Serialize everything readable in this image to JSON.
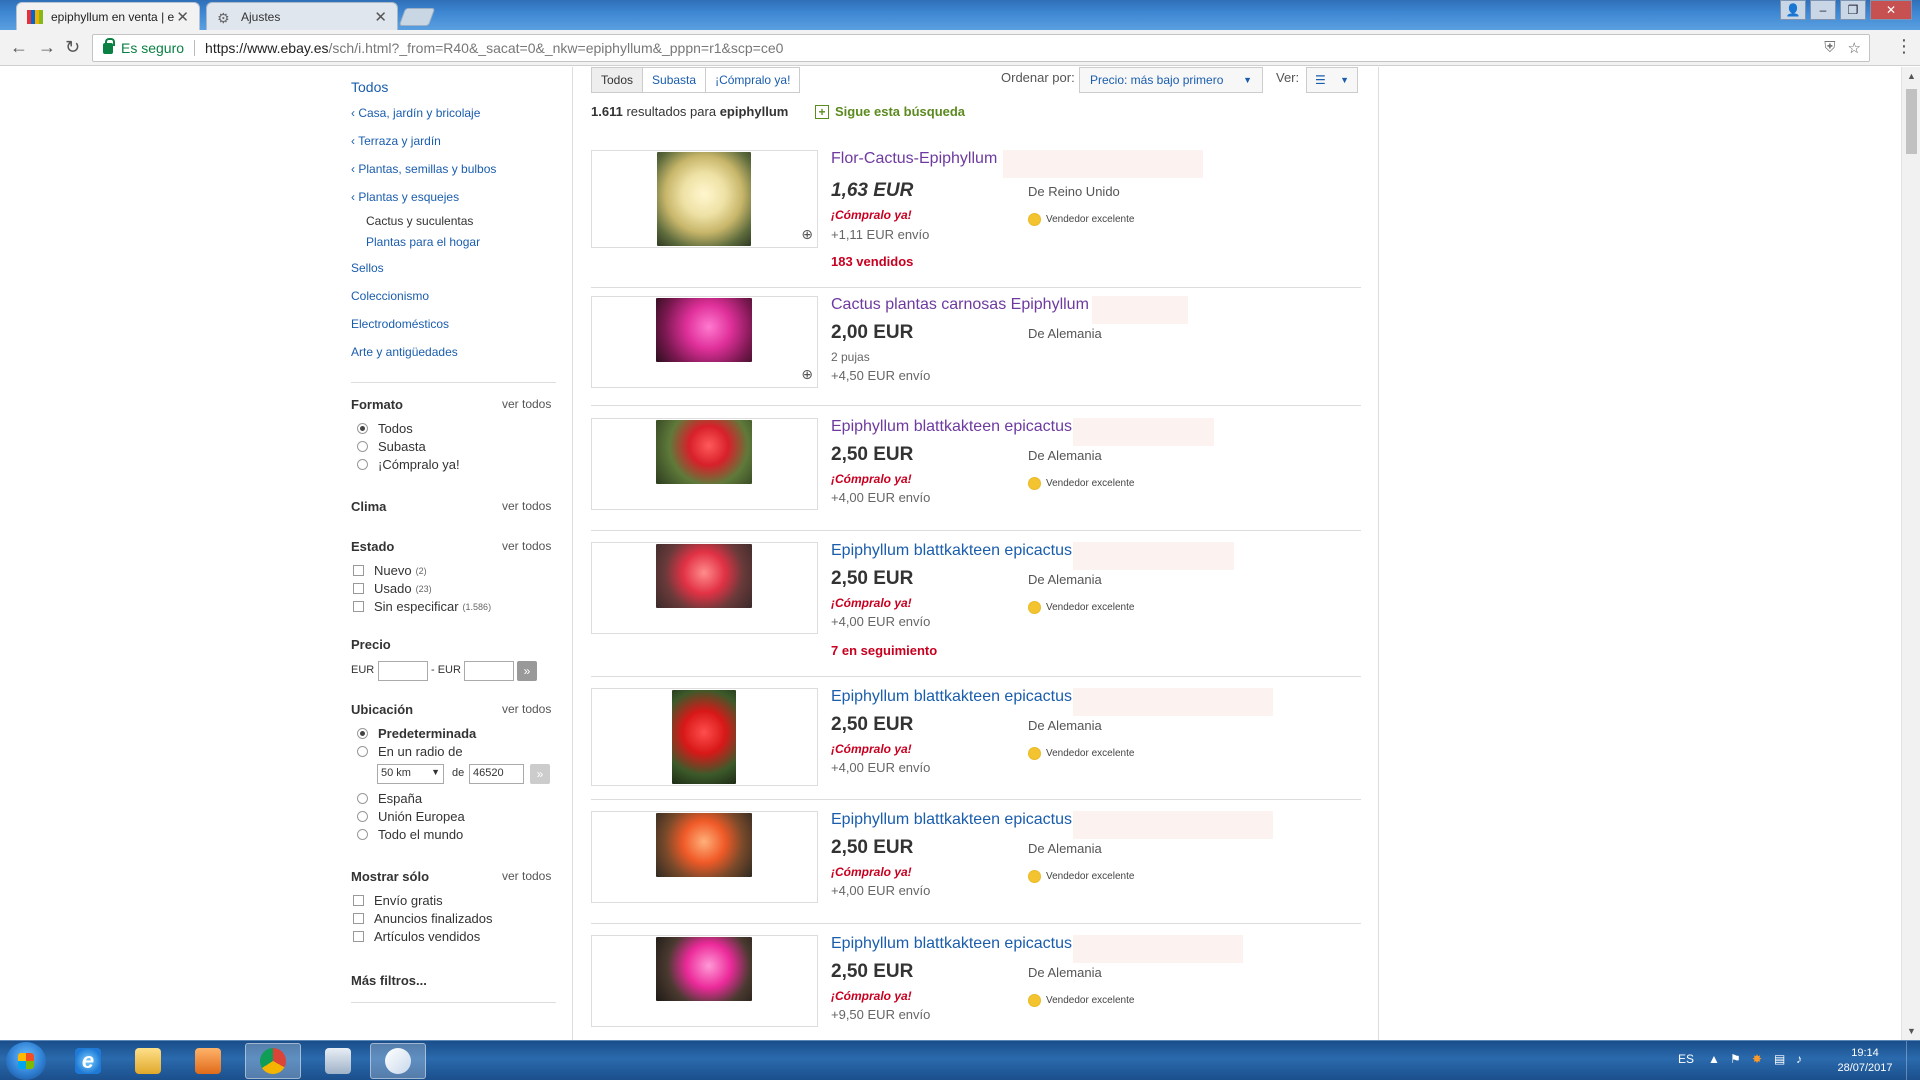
{
  "browser": {
    "tabs": [
      {
        "title": "epiphyllum en venta | e",
        "active": true
      },
      {
        "title": "Ajustes",
        "active": false
      }
    ],
    "secure_label": "Es seguro",
    "url_host": "https://www.ebay.es",
    "url_path": "/sch/i.html?_from=R40&_sacat=0&_nkw=epiphyllum&_pppn=r1&scp=ce0"
  },
  "sidebar": {
    "categories": [
      {
        "label": "Todos"
      },
      {
        "label": "Casa, jardín y bricolaje"
      },
      {
        "label": "Terraza y jardín"
      },
      {
        "label": "Plantas, semillas y bulbos"
      },
      {
        "label": "Plantas y esquejes"
      },
      {
        "label": "Cactus y suculentas"
      },
      {
        "label": "Plantas para el hogar"
      },
      {
        "label": "Sellos"
      },
      {
        "label": "Coleccionismo"
      },
      {
        "label": "Electrodomésticos"
      },
      {
        "label": "Arte y antigüedades"
      }
    ],
    "see_all": "ver todos",
    "formato": {
      "title": "Formato",
      "options": [
        "Todos",
        "Subasta",
        "¡Cómpralo ya!"
      ]
    },
    "clima": {
      "title": "Clima"
    },
    "estado": {
      "title": "Estado",
      "options": [
        {
          "label": "Nuevo",
          "count": "(2)"
        },
        {
          "label": "Usado",
          "count": "(23)"
        },
        {
          "label": "Sin especificar",
          "count": "(1.586)"
        }
      ]
    },
    "precio": {
      "title": "Precio",
      "currency": "EUR",
      "sep": "- EUR"
    },
    "ubicacion": {
      "title": "Ubicación",
      "options": [
        "Predeterminada",
        "En un radio de",
        "España",
        "Unión Europea",
        "Todo el mundo"
      ],
      "radius": "50 km",
      "de": "de",
      "postcode": "46520"
    },
    "mostrar": {
      "title": "Mostrar sólo",
      "options": [
        "Envío gratis",
        "Anuncios finalizados",
        "Artículos vendidos"
      ]
    },
    "more_filters": "Más filtros..."
  },
  "controls": {
    "format_tabs": [
      "Todos",
      "Subasta",
      "¡Cómpralo ya!"
    ],
    "sort_label": "Ordenar por:",
    "sort_value": "Precio: más bajo primero",
    "view_label": "Ver:",
    "results_count": "1.611",
    "results_text": "resultados para",
    "query": "epiphyllum",
    "follow": "Sigue esta búsqueda"
  },
  "listings": [
    {
      "title": "Flor-Cactus-Epiphyllum",
      "price": "1,63 EUR",
      "buy_now": "¡Cómpralo ya!",
      "shipping": "+1,11 EUR envío",
      "from": "De Reino Unido",
      "seller": "Vendedor excelente",
      "extra": "183 vendidos",
      "visited": true
    },
    {
      "title": "Cactus plantas carnosas Epiphyllum",
      "price": "2,00 EUR",
      "bids": "2 pujas",
      "shipping": "+4,50 EUR envío",
      "from": "De Alemania",
      "visited": true
    },
    {
      "title": "Epiphyllum blattkakteen epicactus",
      "price": "2,50 EUR",
      "buy_now": "¡Cómpralo ya!",
      "shipping": "+4,00 EUR envío",
      "from": "De Alemania",
      "seller": "Vendedor excelente",
      "visited": true
    },
    {
      "title": "Epiphyllum blattkakteen epicactus",
      "price": "2,50 EUR",
      "buy_now": "¡Cómpralo ya!",
      "shipping": "+4,00 EUR envío",
      "from": "De Alemania",
      "seller": "Vendedor excelente",
      "extra": "7 en seguimiento"
    },
    {
      "title": "Epiphyllum blattkakteen epicactus",
      "price": "2,50 EUR",
      "buy_now": "¡Cómpralo ya!",
      "shipping": "+4,00 EUR envío",
      "from": "De Alemania",
      "seller": "Vendedor excelente"
    },
    {
      "title": "Epiphyllum blattkakteen epicactus",
      "price": "2,50 EUR",
      "buy_now": "¡Cómpralo ya!",
      "shipping": "+4,00 EUR envío",
      "from": "De Alemania",
      "seller": "Vendedor excelente"
    },
    {
      "title": "Epiphyllum blattkakteen epicactus",
      "price": "2,50 EUR",
      "buy_now": "¡Cómpralo ya!",
      "shipping": "+9,50 EUR envío",
      "from": "De Alemania",
      "seller": "Vendedor excelente"
    }
  ],
  "taskbar": {
    "lang": "ES",
    "time": "19:14",
    "date": "28/07/2017"
  }
}
